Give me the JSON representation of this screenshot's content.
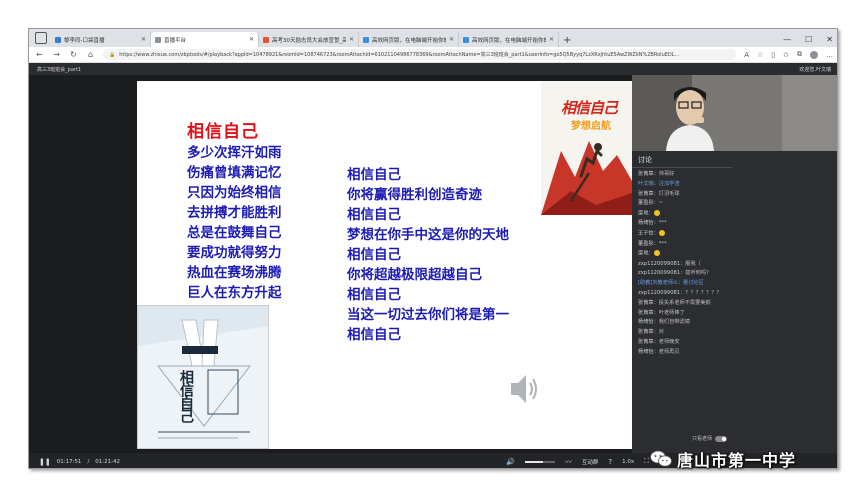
{
  "browser": {
    "tabs": [
      {
        "label": "黎李同-口袋直播",
        "favicon_color": "#3a7bd5",
        "active": false
      },
      {
        "label": "直播平台",
        "favicon_color": "#8a8f99",
        "active": true
      },
      {
        "label": "高考30天励志员大会放宣誓_高中教育",
        "favicon_color": "#e8542f",
        "active": false
      },
      {
        "label": "高效网页版，在电脑端开始你的网课...",
        "favicon_color": "#3b8ee8",
        "active": false
      },
      {
        "label": "高效网页版，在电脑端开始你的网课...",
        "favicon_color": "#3b8ee8",
        "active": false
      }
    ],
    "url": "https://www.zhixue.com/zbptools/#/playback?appId=10478921&roomId=108746723&roomAttachId=61021104986778369&roomAttachName=高三3班班会_part1&userInfo=go5Q5Byyq7LzXRxjhtuE5AwZWZkN%2BRoIuEDL..."
  },
  "video": {
    "title": "高三3班班会_part1",
    "welcome": "欢迎您,叶文瑞"
  },
  "slide": {
    "title": "相信自己",
    "lines_left": [
      "多少次挥汗如雨",
      "伤痛曾填满记忆",
      "只因为始终相信",
      "去拼搏才能胜利",
      "总是在鼓舞自己",
      "要成功就得努力",
      "热血在赛场沸腾",
      "巨人在东方升起"
    ],
    "lines_right": [
      "相信自己",
      "你将赢得胜利创造奇迹",
      "相信自己",
      "梦想在你手中这是你的天地",
      "相信自己",
      "你将超越极限超越自己",
      "相信自己",
      "当这一切过去你们将是第一",
      "相信自己"
    ],
    "poster_top_text": "相信自己",
    "poster_top_sub": "梦想启航",
    "poster_bottom_text": "相信自己"
  },
  "discussion": {
    "title": "讨论",
    "messages": [
      {
        "user": "张莨章",
        "text": "帅哥好",
        "highlight": false,
        "emoji": false
      },
      {
        "user": "叶文瑞",
        "text": "注加学渣",
        "highlight": true,
        "emoji": false
      },
      {
        "user": "张莨章",
        "text": "打羽毛球",
        "highlight": false,
        "emoji": false
      },
      {
        "user": "董盈彤",
        "text": "~",
        "highlight": false,
        "emoji": false
      },
      {
        "user": "梁地",
        "text": "",
        "highlight": false,
        "emoji": true
      },
      {
        "user": "杨绮怡",
        "text": "***",
        "highlight": false,
        "emoji": false
      },
      {
        "user": "王子怡",
        "text": "",
        "highlight": false,
        "emoji": true
      },
      {
        "user": "董盈彤",
        "text": "***",
        "highlight": false,
        "emoji": false
      },
      {
        "user": "梁地",
        "text": "",
        "highlight": false,
        "emoji": true
      },
      {
        "user": "zxp1120099081",
        "text": "服我（",
        "highlight": false,
        "emoji": false
      },
      {
        "user": "zxp1120099081",
        "text": "能听到吗？",
        "highlight": false,
        "emoji": false
      },
      {
        "user": "[助教]刘教老师①",
        "text": "看讨论区",
        "highlight": true,
        "emoji": false
      },
      {
        "user": "zxp1120099081",
        "text": "？？？？？？？",
        "highlight": false,
        "emoji": false
      },
      {
        "user": "张莨章",
        "text": "投失系老师不需要美颜",
        "highlight": false,
        "emoji": false
      },
      {
        "user": "张莨章",
        "text": "叶老师棒了",
        "highlight": false,
        "emoji": false
      },
      {
        "user": "杨绮怡",
        "text": "我们自带滤镜",
        "highlight": false,
        "emoji": false
      },
      {
        "user": "张莨章",
        "text": "对",
        "highlight": false,
        "emoji": false
      },
      {
        "user": "张莨章",
        "text": "老师晚安",
        "highlight": false,
        "emoji": false
      },
      {
        "user": "杨绮怡",
        "text": "老师再见",
        "highlight": false,
        "emoji": false
      }
    ],
    "only_teacher_label": "只看老师"
  },
  "player": {
    "current_time": "01:17:51",
    "total_time": "01:21:42",
    "progress": 0.953,
    "volume": 0.6,
    "interact_label": "互动群",
    "speed": "1.0x"
  },
  "watermark": {
    "text": "唐山市第一中学"
  }
}
